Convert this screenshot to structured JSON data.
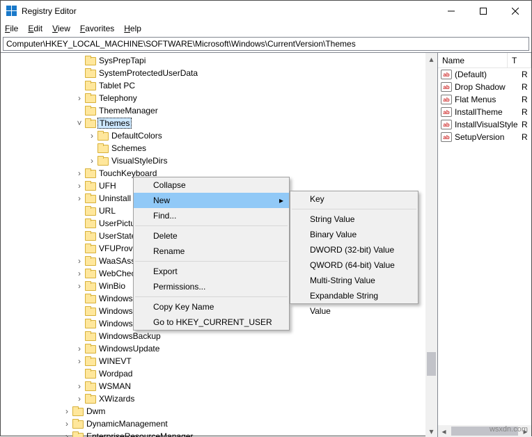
{
  "window": {
    "title": "Registry Editor"
  },
  "menubar": {
    "items": [
      "File",
      "Edit",
      "View",
      "Favorites",
      "Help"
    ]
  },
  "addressbar": {
    "path": "Computer\\HKEY_LOCAL_MACHINE\\SOFTWARE\\Microsoft\\Windows\\CurrentVersion\\Themes"
  },
  "tree": {
    "items": [
      {
        "indent": 106,
        "exp": "",
        "label": "SysPrepTapi"
      },
      {
        "indent": 106,
        "exp": "",
        "label": "SystemProtectedUserData"
      },
      {
        "indent": 106,
        "exp": "",
        "label": "Tablet PC"
      },
      {
        "indent": 106,
        "exp": "›",
        "label": "Telephony"
      },
      {
        "indent": 106,
        "exp": "",
        "label": "ThemeManager"
      },
      {
        "indent": 106,
        "exp": "v",
        "label": "Themes",
        "selected": true
      },
      {
        "indent": 124,
        "exp": "›",
        "label": "DefaultColors"
      },
      {
        "indent": 124,
        "exp": "",
        "label": "Schemes"
      },
      {
        "indent": 124,
        "exp": "›",
        "label": "VisualStyleDirs"
      },
      {
        "indent": 106,
        "exp": "›",
        "label": "TouchKeyboard"
      },
      {
        "indent": 106,
        "exp": "›",
        "label": "UFH"
      },
      {
        "indent": 106,
        "exp": "›",
        "label": "Uninstall"
      },
      {
        "indent": 106,
        "exp": "",
        "label": "URL"
      },
      {
        "indent": 106,
        "exp": "",
        "label": "UserPictureChange"
      },
      {
        "indent": 106,
        "exp": "",
        "label": "UserState"
      },
      {
        "indent": 106,
        "exp": "",
        "label": "VFUProvider"
      },
      {
        "indent": 106,
        "exp": "›",
        "label": "WaaSAssessment"
      },
      {
        "indent": 106,
        "exp": "›",
        "label": "WebCheck"
      },
      {
        "indent": 106,
        "exp": "›",
        "label": "WinBio"
      },
      {
        "indent": 106,
        "exp": "",
        "label": "Windows Block Level Backup"
      },
      {
        "indent": 106,
        "exp": "",
        "label": "Windows To Go"
      },
      {
        "indent": 106,
        "exp": "",
        "label": "WindowsAnytimeUpgrade"
      },
      {
        "indent": 106,
        "exp": "",
        "label": "WindowsBackup"
      },
      {
        "indent": 106,
        "exp": "›",
        "label": "WindowsUpdate"
      },
      {
        "indent": 106,
        "exp": "›",
        "label": "WINEVT"
      },
      {
        "indent": 106,
        "exp": "",
        "label": "Wordpad"
      },
      {
        "indent": 106,
        "exp": "›",
        "label": "WSMAN"
      },
      {
        "indent": 106,
        "exp": "›",
        "label": "XWizards"
      },
      {
        "indent": 88,
        "exp": "›",
        "label": "Dwm"
      },
      {
        "indent": 88,
        "exp": "›",
        "label": "DynamicManagement"
      },
      {
        "indent": 88,
        "exp": "›",
        "label": "EnterpriseResourceManager"
      }
    ]
  },
  "values": {
    "columns": [
      "Name",
      "T"
    ],
    "rows": [
      {
        "name": "(Default)",
        "type": "R"
      },
      {
        "name": "Drop Shadow",
        "type": "R"
      },
      {
        "name": "Flat Menus",
        "type": "R"
      },
      {
        "name": "InstallTheme",
        "type": "R"
      },
      {
        "name": "InstallVisualStyle",
        "type": "R"
      },
      {
        "name": "SetupVersion",
        "type": "R"
      }
    ]
  },
  "context1": {
    "items": [
      {
        "type": "item",
        "label": "Collapse"
      },
      {
        "type": "item",
        "label": "New",
        "hl": true,
        "arrow": true
      },
      {
        "type": "item",
        "label": "Find..."
      },
      {
        "type": "sep"
      },
      {
        "type": "item",
        "label": "Delete"
      },
      {
        "type": "item",
        "label": "Rename"
      },
      {
        "type": "sep"
      },
      {
        "type": "item",
        "label": "Export"
      },
      {
        "type": "item",
        "label": "Permissions..."
      },
      {
        "type": "sep"
      },
      {
        "type": "item",
        "label": "Copy Key Name"
      },
      {
        "type": "item",
        "label": "Go to HKEY_CURRENT_USER"
      }
    ]
  },
  "context2": {
    "items": [
      {
        "type": "item",
        "label": "Key"
      },
      {
        "type": "sep"
      },
      {
        "type": "item",
        "label": "String Value"
      },
      {
        "type": "item",
        "label": "Binary Value"
      },
      {
        "type": "item",
        "label": "DWORD (32-bit) Value"
      },
      {
        "type": "item",
        "label": "QWORD (64-bit) Value"
      },
      {
        "type": "item",
        "label": "Multi-String Value"
      },
      {
        "type": "item",
        "label": "Expandable String Value"
      }
    ]
  },
  "watermark": "wsxdn.com"
}
